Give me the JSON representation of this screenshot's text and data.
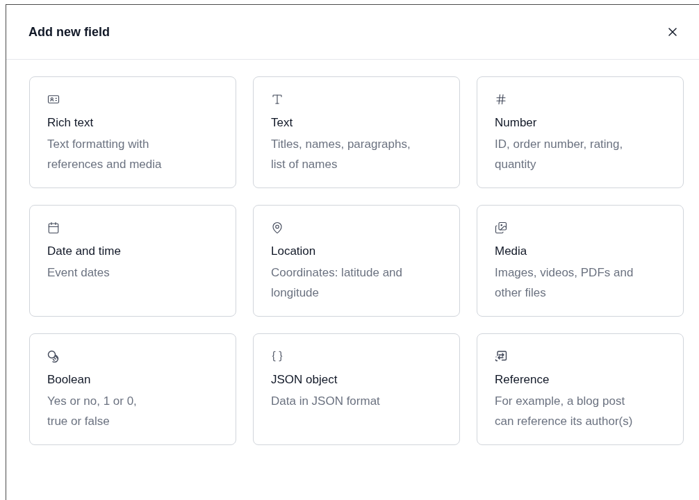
{
  "dialog": {
    "title": "Add new field"
  },
  "field_types": [
    {
      "kind": "rich",
      "name": "Rich text",
      "description": "Text formatting with references and media"
    },
    {
      "kind": "text",
      "name": "Text",
      "description": "Titles, names, paragraphs, list of names"
    },
    {
      "kind": "number",
      "name": "Number",
      "description": "ID, order number, rating, quantity"
    },
    {
      "kind": "date",
      "name": "Date and time",
      "description": "Event dates"
    },
    {
      "kind": "location",
      "name": "Location",
      "description": "Coordinates: latitude and longitude"
    },
    {
      "kind": "media",
      "name": "Media",
      "description": "Images, videos, PDFs and other files"
    },
    {
      "kind": "boolean",
      "name": "Boolean",
      "description": "Yes or no, 1 or 0,\ntrue or false"
    },
    {
      "kind": "json",
      "name": "JSON object",
      "description": "Data in JSON format"
    },
    {
      "kind": "reference",
      "name": "Reference",
      "description": "For example, a blog post can reference its author(s)"
    }
  ]
}
